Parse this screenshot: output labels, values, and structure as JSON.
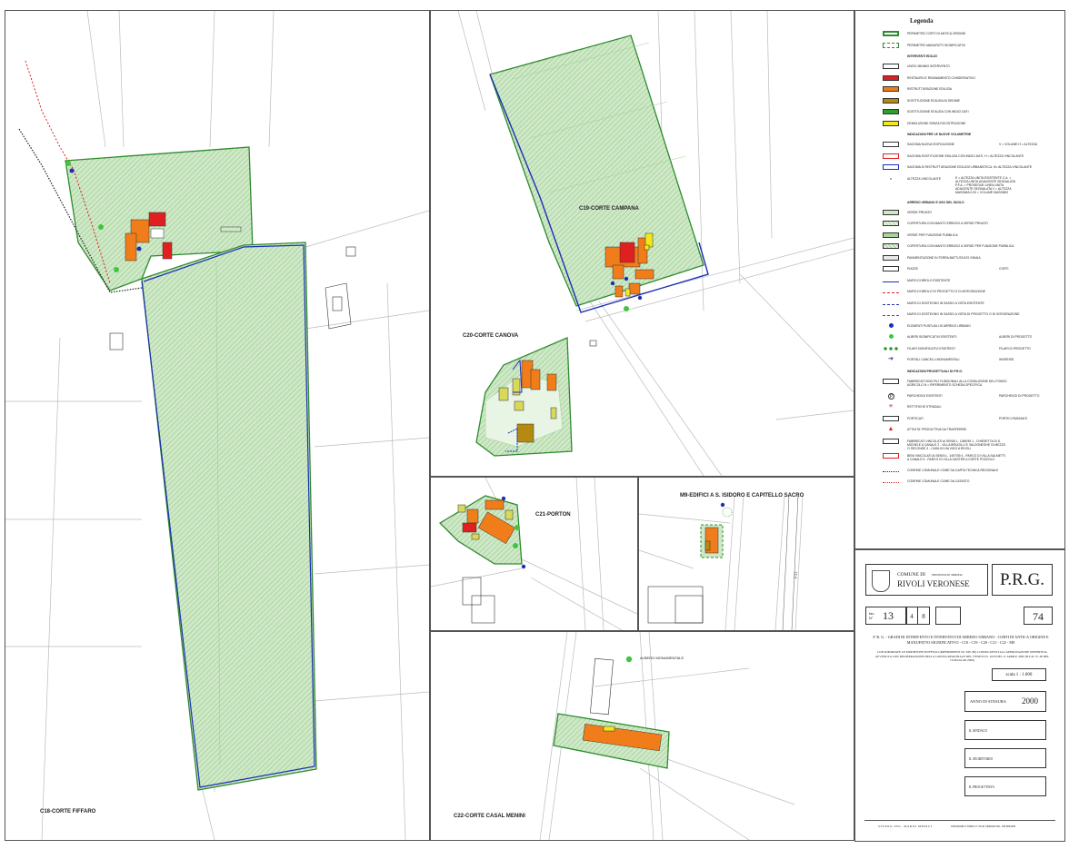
{
  "map_labels": {
    "c18": "C18-CORTE FIFFARO",
    "c19": "C19-CORTE CAMPANA",
    "c20": "C20-CORTE CANOVA",
    "c21": "C21-PORTON",
    "m9": "M9-EDIFICI A S. ISIDORO E CAPITELLO SACRO",
    "c22": "C22-CORTE CASAL MENINI",
    "albero": "ALBERO MONUMENTALE",
    "a22": "A 22"
  },
  "legend": {
    "title": "Legenda",
    "items": [
      {
        "label": "PERIMETRO CORTI DI ANTICA ORIGINE",
        "color": "#2e8b2e",
        "style": "solid"
      },
      {
        "label": "PERIMETRO MANUFATTI SIGNIFICATIVI",
        "color": "#2e8b2e",
        "style": "dashed"
      },
      {
        "label": "INTERVENTI EDILIZI",
        "heading": true
      },
      {
        "label": "UNITA' MINIMO INTERVENTO",
        "color": "#ffffff",
        "style": "box"
      },
      {
        "label": "RESTAURO E RISANAMENTO CONSERVATIVO",
        "color": "#e02020",
        "style": "fill"
      },
      {
        "label": "RISTRUTTURAZIONE EDILIZIA",
        "color": "#f07d1a",
        "style": "fill"
      },
      {
        "label": "SOSTITUZIONE EDILIZIA IN SEDIME",
        "color": "#b58a10",
        "style": "fill"
      },
      {
        "label": "SOSTITUZIONE EDILIZIA CON INDICI DATI",
        "color": "#2aa22a",
        "style": "fill"
      },
      {
        "label": "DEMOLIZIONE SENZA RICOSTRUZIONE",
        "color": "#f2e81a",
        "style": "fill"
      },
      {
        "label": "INDICAZIONI PER LE NUOVE VOLUMETRIE",
        "heading": true
      },
      {
        "label": "SAGOMA NUOVA EDIFICAZIONE",
        "color": "#ffffff",
        "style": "box",
        "extra": "V = Volume  H = Altezza"
      },
      {
        "label": "SAGOMA SOSTITUZIONE EDILIZIA CON INDICI DATI, h = ALTEZZA VINCOLANTE",
        "color": "#ffffff",
        "style": "redbox"
      },
      {
        "label": "SAGOMA DI RISTRUTTURAZIONE EDILIZIO URBANISTICA, n= ALTEZZA VINCOLANTE",
        "color": "#ffffff",
        "style": "bluebox"
      },
      {
        "label": "ALTEZZA VINCOLANTE",
        "color": "#ffffff",
        "style": "none",
        "extra": "E = altezza unita esistente  C.A. = altezza unita adiacente segnalata  P.F.A. = prosegue linea unita adiacente segnalata  v = altezza massima  0.00 = volume massimo"
      },
      {
        "label": "ARREDO URBANO E USO DEL SUOLO",
        "heading": true
      },
      {
        "label": "VERDE PRIVATO",
        "color": "#cfe8c8",
        "style": "fill"
      },
      {
        "label": "COPERTURA CON MANTO ERBOSO A VERDE PRIVATO",
        "color": "#b8dcaf",
        "style": "hatch"
      },
      {
        "label": "VERDE PER FUNZIONE PUBBLICA",
        "color": "#a7d69d",
        "style": "fill"
      },
      {
        "label": "COPERTURA CON MANTO ERBOSO A VERDE PER FUNZIONE PUBBLICA",
        "color": "#9fd094",
        "style": "hatch"
      },
      {
        "label": "PAVIMENTAZIONE IN TERRA BATTUTA E/O GHIAIA",
        "color": "#e8e8e8",
        "style": "fill"
      },
      {
        "label": "PIAZZE",
        "color": "#ffffff",
        "style": "box",
        "extra": "CORTI"
      },
      {
        "label": "MURO DI BROLO ESISTENTE",
        "color": "#1d2fb5",
        "style": "line"
      },
      {
        "label": "MURO DI BROLO DI PROGETTO O DI INTEGRAZIONE",
        "color": "#e02020",
        "style": "dashline"
      },
      {
        "label": "MURO DI SOSTEGNO IN SASSO A VISTA ESISTENTE",
        "color": "#1d2fb5",
        "style": "dashline"
      },
      {
        "label": "MURO DI SOSTEGNO IN SASSO A VISTA DI PROGETTO O DI INTEGRAZIONE",
        "color": "#e02020",
        "style": "dashline"
      },
      {
        "label": "ELEMENTI PUNTUALI DI ARREDO URBANO",
        "color": "#1d2fb5",
        "style": "dot"
      },
      {
        "label": "ALBERI SIGNIFICATIVI ESISTENTI",
        "color": "#3fc63f",
        "style": "dot",
        "extra": "ALBERI DI PROGETTO"
      },
      {
        "label": "FILARI SIGNIFICATIVI ESISTENTI",
        "color": "#2a9a2a",
        "style": "dots",
        "extra": "FILARI DI PROGETTO"
      },
      {
        "label": "PORTALI CANCELLI MONUMENTALI",
        "color": "#1d2fb5",
        "style": "arrow",
        "extra": "INGRESSI"
      },
      {
        "label": "INDICAZIONI PROGETTUALI DI P.R.G.",
        "heading": true
      },
      {
        "label": "FABBRICATI NON PIU' FUNZIONALI ALLA CONDUZIONE DEL FONDO AGRICOLO n = RIFERIMENTO SCHEDA SPECIFICA",
        "color": "#ffffff",
        "style": "box"
      },
      {
        "label": "PARCHEGGI ESISTENTI",
        "color": "#ffffff",
        "style": "p",
        "extra": "PARCHEGGI DI PROGETTO"
      },
      {
        "label": "RETTIFICHE STRADALI",
        "color": "#e02020",
        "style": "star"
      },
      {
        "label": "PORTICATI",
        "color": "#2aa22a",
        "style": "box",
        "extra": "PORTICI PASSANTI"
      },
      {
        "label": "ATTIVITA' PRODUTTIVA DA TRASFERIRE",
        "color": "#e02020",
        "style": "tri"
      },
      {
        "label": "FABBRICATI VINCOLATI AI SENSI L. 1089/39  1 - CHIESETTA DI S. MICHELE A CANALE  2 - VILLA BRUGILLI E VALDONEGHE DI MEZZO O SECONDE  3 - CASA IN VIA VIGO A RIVOLI",
        "color": "#ffffff",
        "style": "box"
      },
      {
        "label": "BENI VINCOLATI AI SENSI L. 1497/39  4 - PARCO DI VILLA SALMETTI A CANALE  5 - PARCO DI VILLA GASTER A CORTE POZZOLO",
        "color": "#ffffff",
        "style": "redbox"
      },
      {
        "label": "CONFINE COMUNALE COME DA CARTA TECNICA REGIONALE",
        "color": "#222222",
        "style": "dotline"
      },
      {
        "label": "CONFINE COMUNALE COME DA CATASTO",
        "color": "#e02020",
        "style": "dotline"
      }
    ]
  },
  "title_block": {
    "comune_di": "COMUNE DI",
    "provincia": "PROVINCIA DI VERONA",
    "comune": "RIVOLI VERONESE",
    "prg": "P.R.G.",
    "tav_label": "tav. N°",
    "tav_number": "13",
    "tav_a": "4",
    "tav_b": "8",
    "sheet": "74",
    "description": "P. R. G. - GRADI DI INTERVENTO E INTERVENTI DI ARREDO URBANO - CORTI DI ANTICA ORIGINE E MANUFATTO SIGNIFICATIVO - C18 - C19 - C20 - C21 - C22 - M9",
    "note": "CON RIPORTATE LE MODIFICHE D'UFFICIO (RIFERIMENTI SU TAV. 80) CONSEGUENTI ALL'APPROVAZIONE DEFINITIVA AVVENUTA CON DELIBERAZIONE DELLA GIUNTA REGIONALE DEL VENETO N. 1018 DEL 11 APRILE 2000 (B.U.R. N. 48 DEL 16 MAGGIO 2000)",
    "scale": "scala  1 : 1.000",
    "anno_label": "ANNO DI STESURA",
    "anno": "2000",
    "sindaco": "IL SINDACO",
    "segretario": "IL SEGRETARIO",
    "progettista": "IL PROGETTISTA",
    "studio": "STUDIO ING. MARIO MEDICI",
    "studio_address": "STRADONE S.TOMIO 17   37121 VERONA   TEL. 045 8034156"
  }
}
